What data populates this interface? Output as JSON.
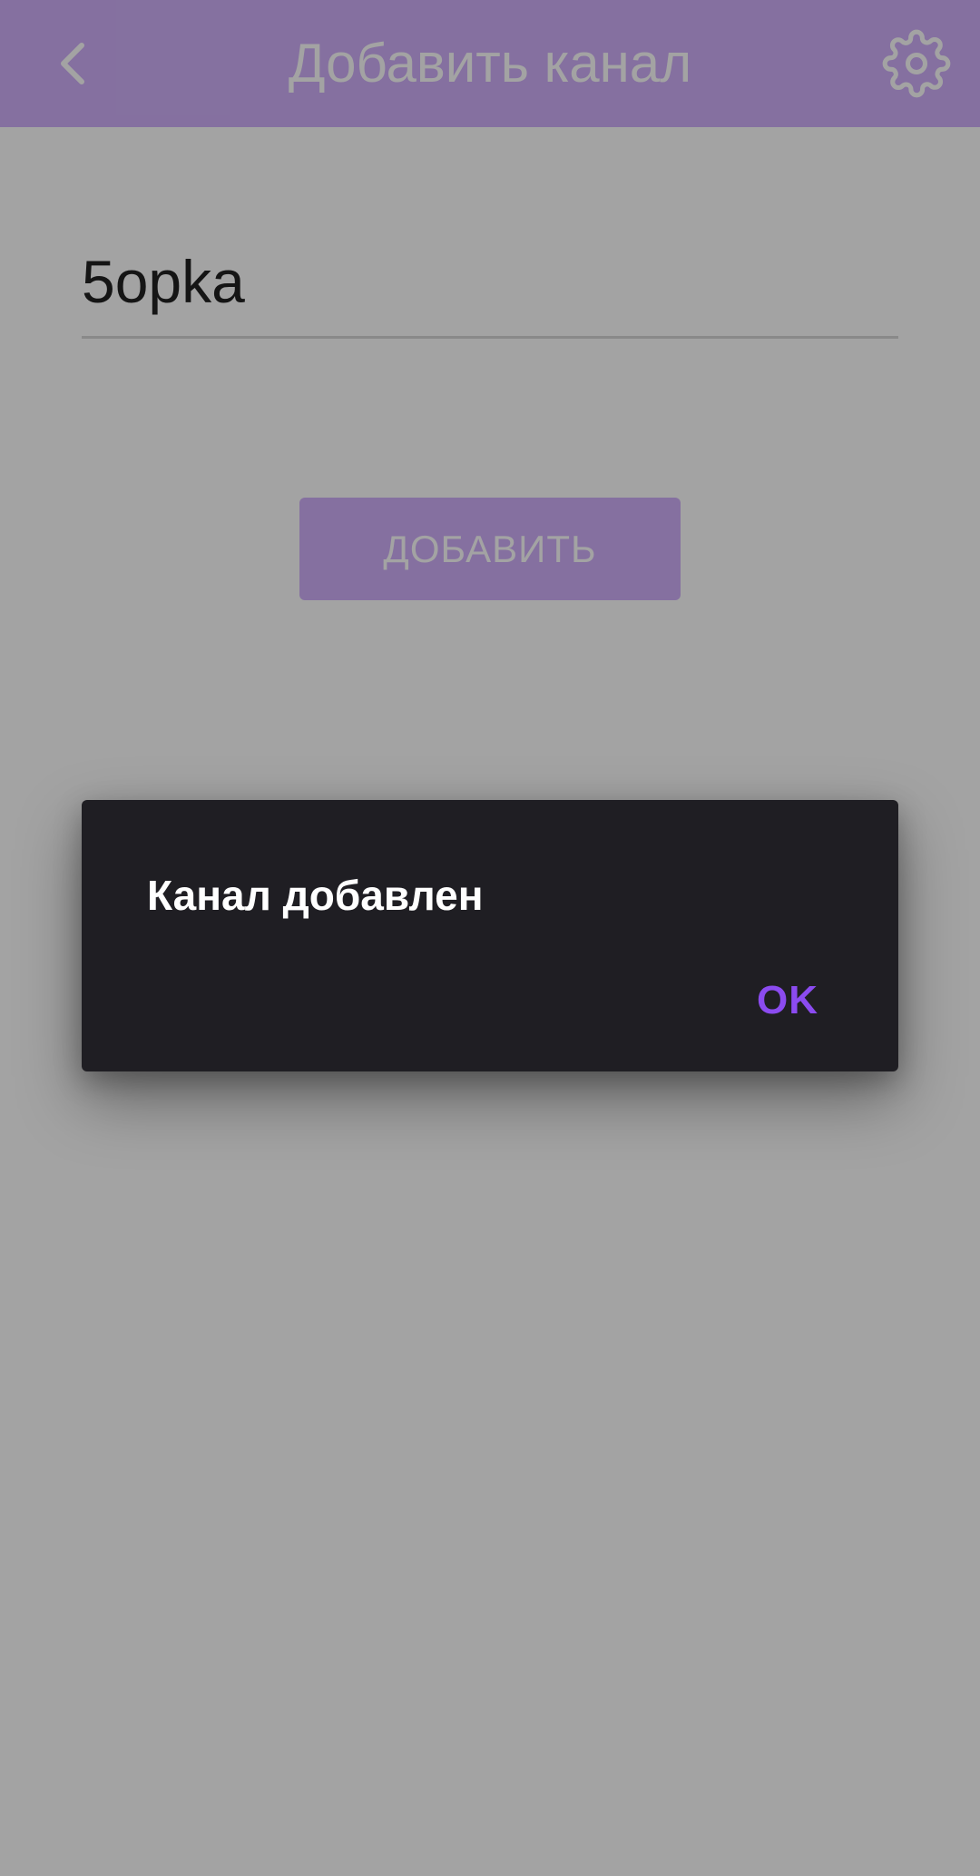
{
  "app_bar": {
    "title": "Добавить канал",
    "back_icon": "chevron-left-icon",
    "settings_icon": "gear-icon",
    "color": "#d0b0fb"
  },
  "form": {
    "channel_input_value": "5opka",
    "add_button_label": "ДОБАВИТЬ"
  },
  "dialog": {
    "message": "Канал добавлен",
    "ok_label": "OK",
    "background": "#1f1e23",
    "accent": "#8b4bf0"
  }
}
